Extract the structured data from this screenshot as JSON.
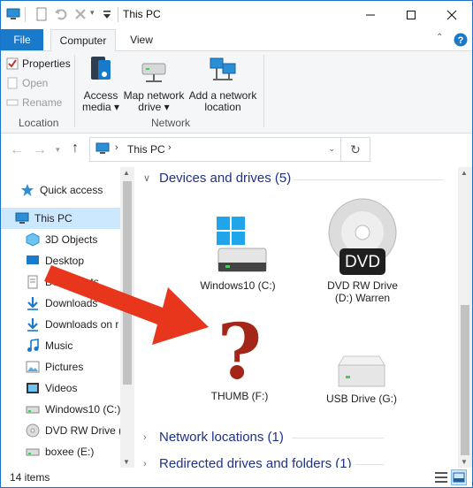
{
  "window": {
    "title": "This PC"
  },
  "quick_access_toolbar": [
    "computer-icon",
    "properties-icon",
    "undo-icon",
    "delete-icon",
    "customize-dropdown"
  ],
  "ribbon_tabs": {
    "file": "File",
    "computer": "Computer",
    "view": "View",
    "active": "Computer"
  },
  "ribbon": {
    "location_group": {
      "label": "Location",
      "properties": "Properties",
      "open": "Open",
      "rename": "Rename"
    },
    "network_group": {
      "label": "Network",
      "access_media_1": "Access",
      "access_media_2": "media",
      "map_drive_1": "Map network",
      "map_drive_2": "drive",
      "add_location_1": "Add a network",
      "add_location_2": "location"
    }
  },
  "address": {
    "path": "This PC",
    "separator": ">"
  },
  "nav_items": [
    {
      "label": "Quick access",
      "icon": "star-icon"
    },
    {
      "label": "This PC",
      "icon": "computer-icon",
      "selected": true
    },
    {
      "label": "3D Objects",
      "icon": "cube-icon"
    },
    {
      "label": "Desktop",
      "icon": "desktop-icon"
    },
    {
      "label": "Documents",
      "icon": "documents-icon"
    },
    {
      "label": "Downloads",
      "icon": "download-icon"
    },
    {
      "label": "Downloads on r",
      "icon": "download-icon"
    },
    {
      "label": "Music",
      "icon": "music-icon"
    },
    {
      "label": "Pictures",
      "icon": "pictures-icon"
    },
    {
      "label": "Videos",
      "icon": "videos-icon"
    },
    {
      "label": "Windows10 (C:)",
      "icon": "drive-icon"
    },
    {
      "label": "DVD RW Drive (",
      "icon": "dvd-icon"
    },
    {
      "label": "boxee (E:)",
      "icon": "drive-icon"
    }
  ],
  "groups": {
    "devices": "Devices and drives (5)",
    "network": "Network locations (1)",
    "redirected": "Redirected drives and folders (1)"
  },
  "drives": {
    "c_label": "Windows10 (C:)",
    "d_label_1": "DVD RW Drive",
    "d_label_2": "(D:) Warren",
    "d_badge": "DVD",
    "f_label": "THUMB (F:)",
    "f_mark": "?",
    "g_label": "USB Drive (G:)"
  },
  "status": {
    "items": "14 items"
  },
  "colors": {
    "accent": "#1979ca",
    "selected": "#cce8ff",
    "annotation": "#e8361d",
    "question": "#a32618"
  }
}
